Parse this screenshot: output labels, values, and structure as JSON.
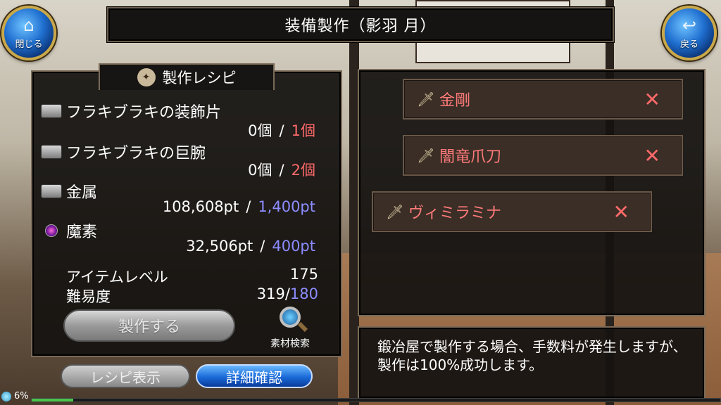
{
  "title": "装備製作（影羽 月）",
  "buttons": {
    "close": "閉じる",
    "back": "戻る",
    "craft": "製作する",
    "material_search": "素材検索",
    "recipe_show": "レシピ表示",
    "detail_confirm": "詳細確認"
  },
  "recipe": {
    "tab_label": "製作レシピ",
    "materials": [
      {
        "name": "フラキブラキの装飾片",
        "have": "0個",
        "need": "1個",
        "need_color": "red",
        "icon": "ingot-icon"
      },
      {
        "name": "フラキブラキの巨腕",
        "have": "0個",
        "need": "2個",
        "need_color": "red",
        "icon": "ingot-icon"
      },
      {
        "name": "金属",
        "have": "108,608pt",
        "need": "1,400pt",
        "need_color": "blue",
        "icon": "ingot-icon"
      },
      {
        "name": "魔素",
        "have": "32,506pt",
        "need": "400pt",
        "need_color": "blue",
        "icon": "orb-icon"
      }
    ],
    "item_level_label": "アイテムレベル",
    "item_level_value": "175",
    "difficulty_label": "難易度",
    "difficulty_value": "319/",
    "difficulty_target": "180"
  },
  "selected_items": [
    {
      "name": "金剛"
    },
    {
      "name": "闇竜爪刀"
    },
    {
      "name": "ヴィミラミナ"
    }
  ],
  "remove_glyph": "✕",
  "message": "鍛冶屋で製作する場合、手数料が発生しますが、製作は100%成功します。",
  "status": {
    "percent_label": "6%",
    "progress": 0.06
  },
  "colors": {
    "required_red": "#ff6a6a",
    "required_blue": "#8c8cff",
    "item_name": "#ff7a7a"
  }
}
